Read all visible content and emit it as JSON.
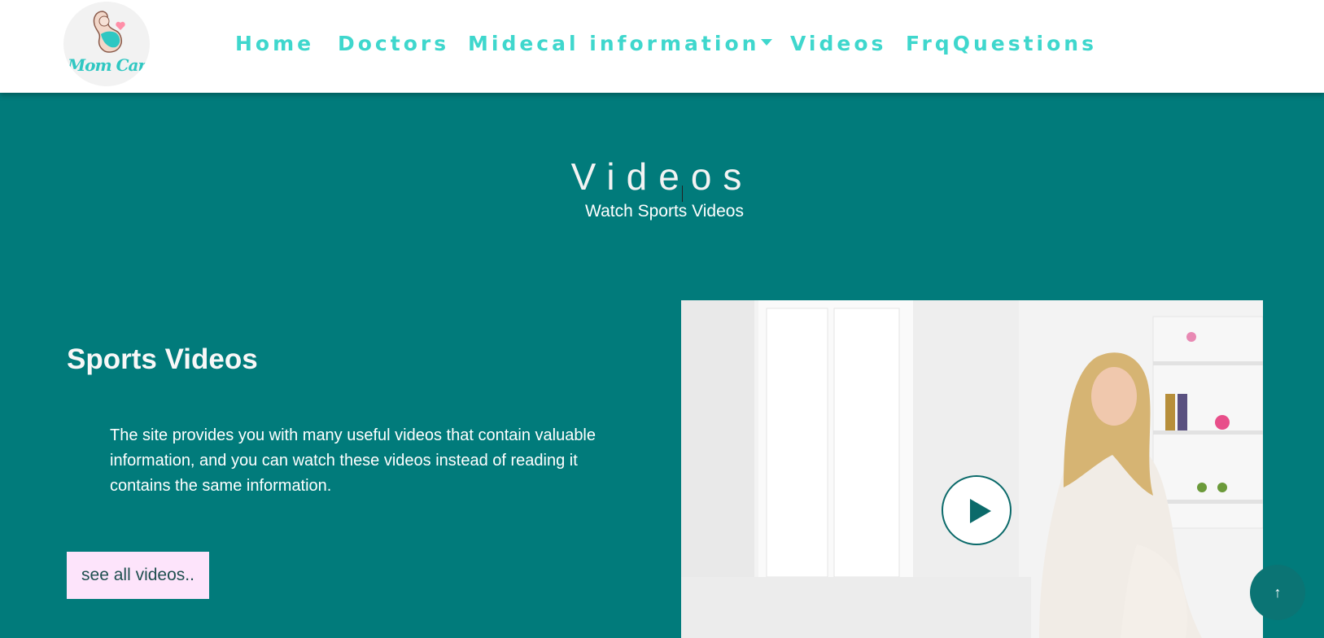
{
  "brand": {
    "logo_text": "Mom Car"
  },
  "nav": {
    "items": [
      {
        "label": "Home"
      },
      {
        "label": "Doctors"
      },
      {
        "label": "Midecal information"
      },
      {
        "label": "Videos"
      },
      {
        "label": "FrqQuestions"
      }
    ]
  },
  "hero": {
    "title": "Videos",
    "subtitle": "Watch Sports Videos"
  },
  "section": {
    "title": "Sports Videos",
    "description": "The site provides you with many useful videos that contain valuable information, and you can watch these videos instead of reading it contains the same information.",
    "button_label": "see all videos.."
  },
  "scroll_top": {
    "icon": "arrow-up-icon",
    "glyph": "↑"
  },
  "colors": {
    "background": "#017b7b",
    "nav_text": "#3fd7cd",
    "button_bg": "#fde4fb",
    "header_bg": "#ffffff"
  }
}
